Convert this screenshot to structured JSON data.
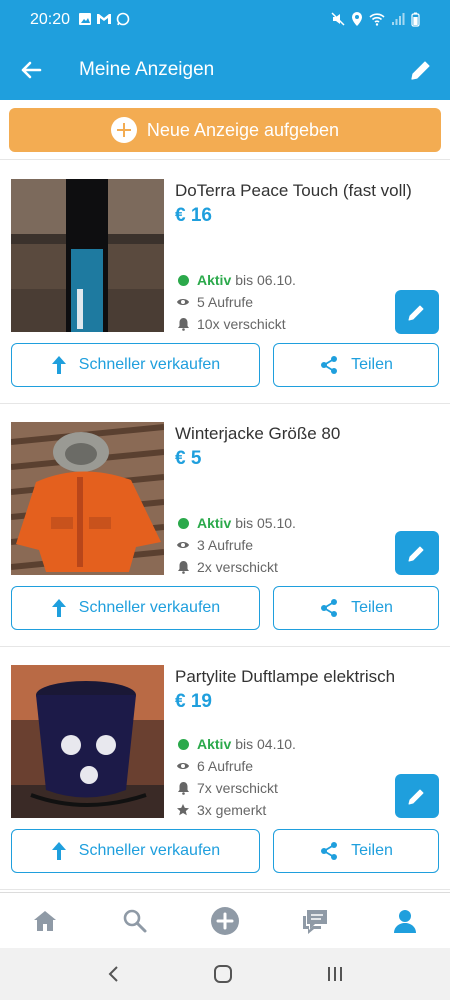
{
  "status_bar": {
    "time": "20:20"
  },
  "app_bar": {
    "title": "Meine Anzeigen"
  },
  "new_ad_button": {
    "label": "Neue Anzeige aufgeben"
  },
  "ads": [
    {
      "title": "DoTerra Peace Touch (fast voll)",
      "price": "€ 16",
      "status": "Aktiv",
      "until": "bis 06.10.",
      "views": "5 Aufrufe",
      "sent": "10x verschickt",
      "faved": "",
      "sell_label": "Schneller verkaufen",
      "share_label": "Teilen"
    },
    {
      "title": "Winterjacke Größe 80",
      "price": "€ 5",
      "status": "Aktiv",
      "until": "bis 05.10.",
      "views": "3 Aufrufe",
      "sent": "2x verschickt",
      "faved": "",
      "sell_label": "Schneller verkaufen",
      "share_label": "Teilen"
    },
    {
      "title": "Partylite Duftlampe elektrisch",
      "price": "€ 19",
      "status": "Aktiv",
      "until": "bis 04.10.",
      "views": "6 Aufrufe",
      "sent": "7x verschickt",
      "faved": "3x gemerkt",
      "sell_label": "Schneller verkaufen",
      "share_label": "Teilen"
    }
  ],
  "colors": {
    "primary": "#1f9fdd",
    "accent_orange": "#f3ac52",
    "active_green": "#2ba94b"
  },
  "bottom_nav": [
    "home-icon",
    "search-icon",
    "add-circle-icon",
    "messages-icon",
    "profile-icon"
  ]
}
